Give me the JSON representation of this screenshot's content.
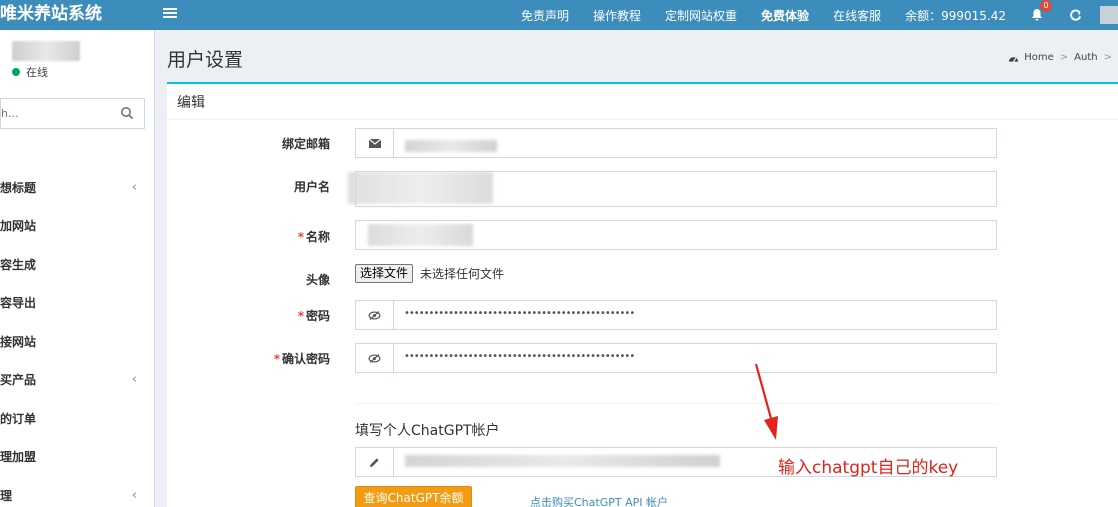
{
  "header": {
    "logo": "唯米养站系统",
    "nav": [
      "免责声明",
      "操作教程",
      "定制网站权重",
      "免费体验",
      "在线客服"
    ],
    "balance_label": "余额：",
    "balance_value": "999015.42",
    "notification_count": "0"
  },
  "sidebar": {
    "status": "在线",
    "search_placeholder": "h...",
    "items": [
      {
        "label": "想标题",
        "has_children": true
      },
      {
        "label": "加网站",
        "has_children": false
      },
      {
        "label": "容生成",
        "has_children": false
      },
      {
        "label": "容导出",
        "has_children": false
      },
      {
        "label": "接网站",
        "has_children": false
      },
      {
        "label": "买产品",
        "has_children": true
      },
      {
        "label": "的订单",
        "has_children": false
      },
      {
        "label": "理加盟",
        "has_children": false
      },
      {
        "label": "理",
        "has_children": true
      }
    ]
  },
  "page": {
    "title": "用户设置",
    "breadcrumb": [
      "Home",
      "Auth"
    ]
  },
  "box": {
    "title": "编辑"
  },
  "form": {
    "email_label": "绑定邮箱",
    "username_label": "用户名",
    "name_label": "名称",
    "avatar_label": "头像",
    "file_button": "选择文件",
    "file_status": "未选择任何文件",
    "password_label": "密码",
    "password_value": "••••••••••••••••••••••••••••••••••••••••••••••••••••••••••••••••••",
    "confirm_label": "确认密码",
    "confirm_value": "••••••••••••••••••••••••••••••••••••••••••••••••••••••••••••••••••",
    "chatgpt_section": "填写个人ChatGPT帐户",
    "query_button": "查询ChatGPT余额",
    "buy_link": "点击购买ChatGPT API 帐户"
  },
  "annotation": {
    "text": "输入chatgpt自己的key",
    "color": "#e4221a"
  },
  "colors": {
    "primary": "#3c8dbc",
    "accent": "#00c0ef",
    "warning": "#f39c12",
    "danger": "#dd4b39",
    "online": "#00a65a"
  }
}
